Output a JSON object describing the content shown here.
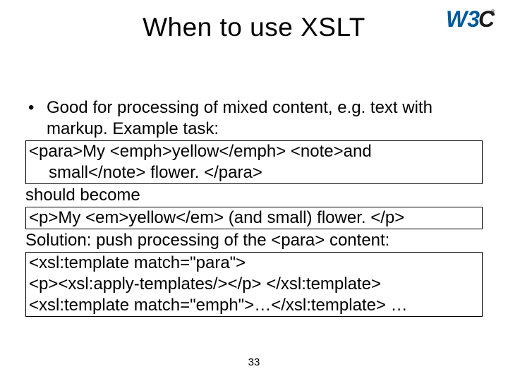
{
  "title": "When to use XSLT",
  "logo": {
    "name": "w3c-logo"
  },
  "bullet": {
    "line1": "Good for processing of mixed content, e.g. text with",
    "line2": "markup. Example task:"
  },
  "code1": {
    "line1": "<para>My <emph>yellow</emph> <note>and",
    "line2": "small</note> flower. </para>"
  },
  "mid1": "should become",
  "code2": {
    "line1": "<p>My <em>yellow</em> (and small) flower. </p>"
  },
  "mid2": "Solution: push processing of the <para> content:",
  "code3": {
    "line1": "<xsl:template match=\"para\">",
    "line2": "<p><xsl:apply-templates/></p> </xsl:template>",
    "line3": "<xsl:template match=\"emph\">…</xsl:template> …"
  },
  "page_number": "33"
}
